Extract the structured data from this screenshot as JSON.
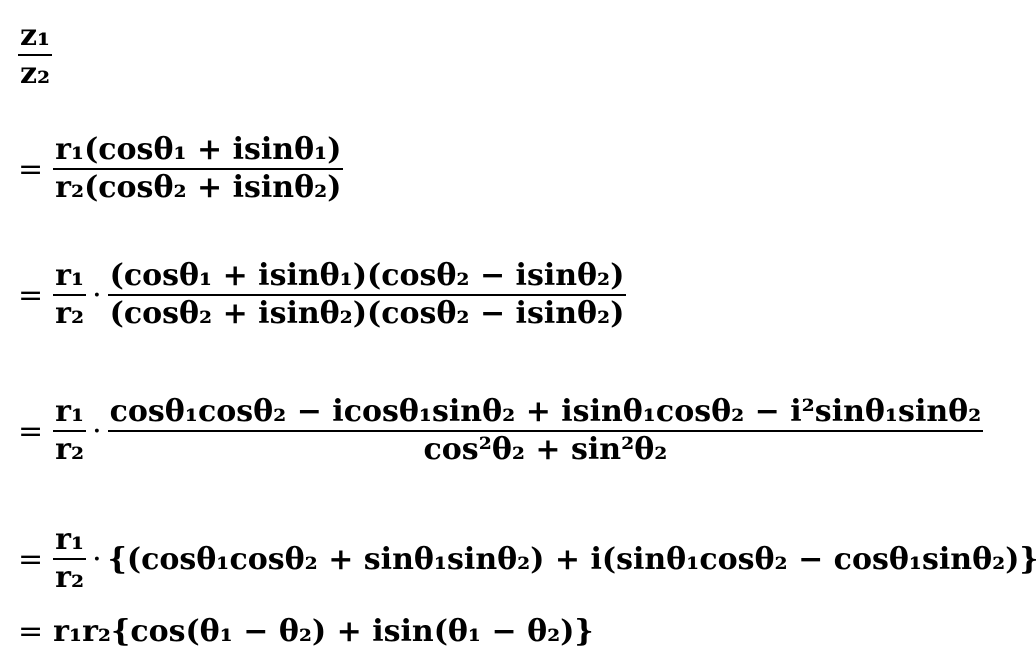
{
  "lines": [
    {
      "type": "frac",
      "prefix": "",
      "num": "z₁",
      "den": "z₂"
    },
    {
      "type": "frac",
      "prefix": "=",
      "num": "r₁(cosθ₁ + isinθ₁)",
      "den": "r₂(cosθ₂ + isinθ₂)"
    },
    {
      "type": "frac2",
      "prefix": "=",
      "num1": "r₁",
      "den1": "r₂",
      "num2": "(cosθ₁ + isinθ₁)(cosθ₂ − isinθ₂)",
      "den2": "(cosθ₂ + isinθ₂)(cosθ₂ − isinθ₂)"
    },
    {
      "type": "frac2",
      "prefix": "=",
      "num1": "r₁",
      "den1": "r₂",
      "num2": "cosθ₁cosθ₂ − icosθ₁sinθ₂ + isinθ₁cosθ₂ − i²sinθ₁sinθ₂",
      "den2": "cos²θ₂ + sin²θ₂"
    },
    {
      "type": "fractext",
      "prefix": "=",
      "num1": "r₁",
      "den1": "r₂",
      "text": "{(cosθ₁cosθ₂ + sinθ₁sinθ₂) + i(sinθ₁cosθ₂ − cosθ₁sinθ₂)}"
    },
    {
      "type": "text",
      "prefix": "=",
      "text": "r₁r₂{cos(θ₁ − θ₂) + isin(θ₁ − θ₂)}"
    }
  ]
}
